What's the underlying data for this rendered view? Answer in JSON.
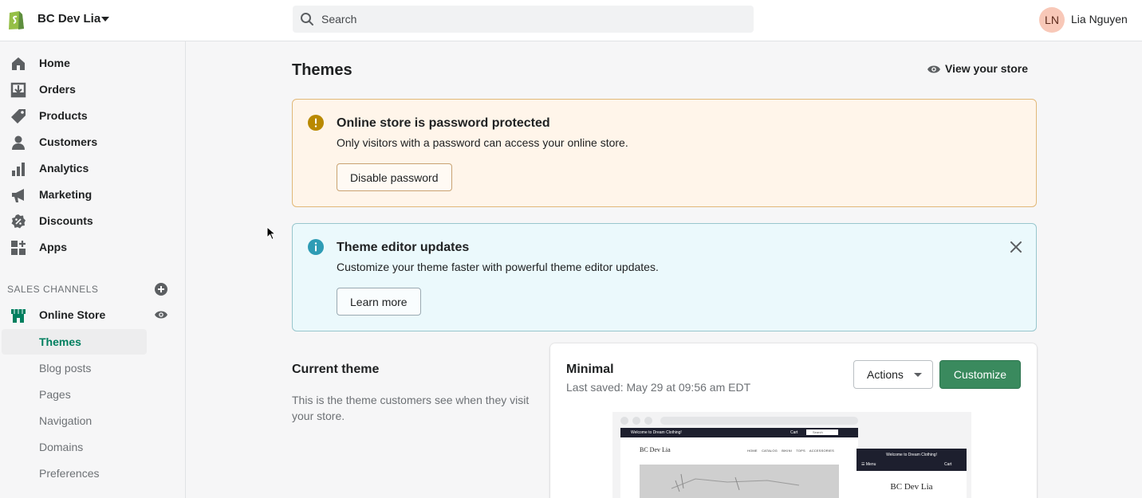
{
  "topbar": {
    "store_name": "BC Dev Lia",
    "search_placeholder": "Search",
    "user_initials": "LN",
    "user_name": "Lia Nguyen"
  },
  "sidebar": {
    "items": [
      {
        "label": "Home",
        "icon": "home-icon"
      },
      {
        "label": "Orders",
        "icon": "orders-icon"
      },
      {
        "label": "Products",
        "icon": "tag-icon"
      },
      {
        "label": "Customers",
        "icon": "person-icon"
      },
      {
        "label": "Analytics",
        "icon": "bar-chart-icon"
      },
      {
        "label": "Marketing",
        "icon": "megaphone-icon"
      },
      {
        "label": "Discounts",
        "icon": "discount-icon"
      },
      {
        "label": "Apps",
        "icon": "apps-icon"
      }
    ],
    "sales_channels_title": "SALES CHANNELS",
    "online_store_label": "Online Store",
    "sub_items": [
      {
        "label": "Themes",
        "active": true
      },
      {
        "label": "Blog posts",
        "active": false
      },
      {
        "label": "Pages",
        "active": false
      },
      {
        "label": "Navigation",
        "active": false
      },
      {
        "label": "Domains",
        "active": false
      },
      {
        "label": "Preferences",
        "active": false
      }
    ]
  },
  "main": {
    "page_title": "Themes",
    "view_store_label": "View your store",
    "password_banner": {
      "title": "Online store is password protected",
      "text": "Only visitors with a password can access your online store.",
      "button": "Disable password"
    },
    "editor_banner": {
      "title": "Theme editor updates",
      "text": "Customize your theme faster with powerful theme editor updates.",
      "button": "Learn more"
    },
    "current_theme": {
      "title": "Current theme",
      "description": "This is the theme customers see when they visit your store."
    },
    "theme_card": {
      "name": "Minimal",
      "last_saved": "Last saved: May 29 at 09:56 am EDT",
      "actions_label": "Actions",
      "customize_label": "Customize"
    },
    "preview": {
      "desktop_welcome": "Welcome to Dream Clothing!",
      "desktop_cart": "Cart",
      "desktop_search": "Search",
      "brand": "BC Dev Lia",
      "menu_items": [
        "HOME",
        "CATALOG",
        "BIKINI",
        "TOPS",
        "ACCESSORIES"
      ],
      "mobile_welcome": "Welcome to Dream Clothing!",
      "mobile_menu": "Menu",
      "mobile_cart": "Cart"
    }
  },
  "colors": {
    "brand_green": "#3a8a5e",
    "active_nav": "#007f5f",
    "warning_bg": "#fff5ea",
    "info_bg": "#ebf9fc"
  }
}
